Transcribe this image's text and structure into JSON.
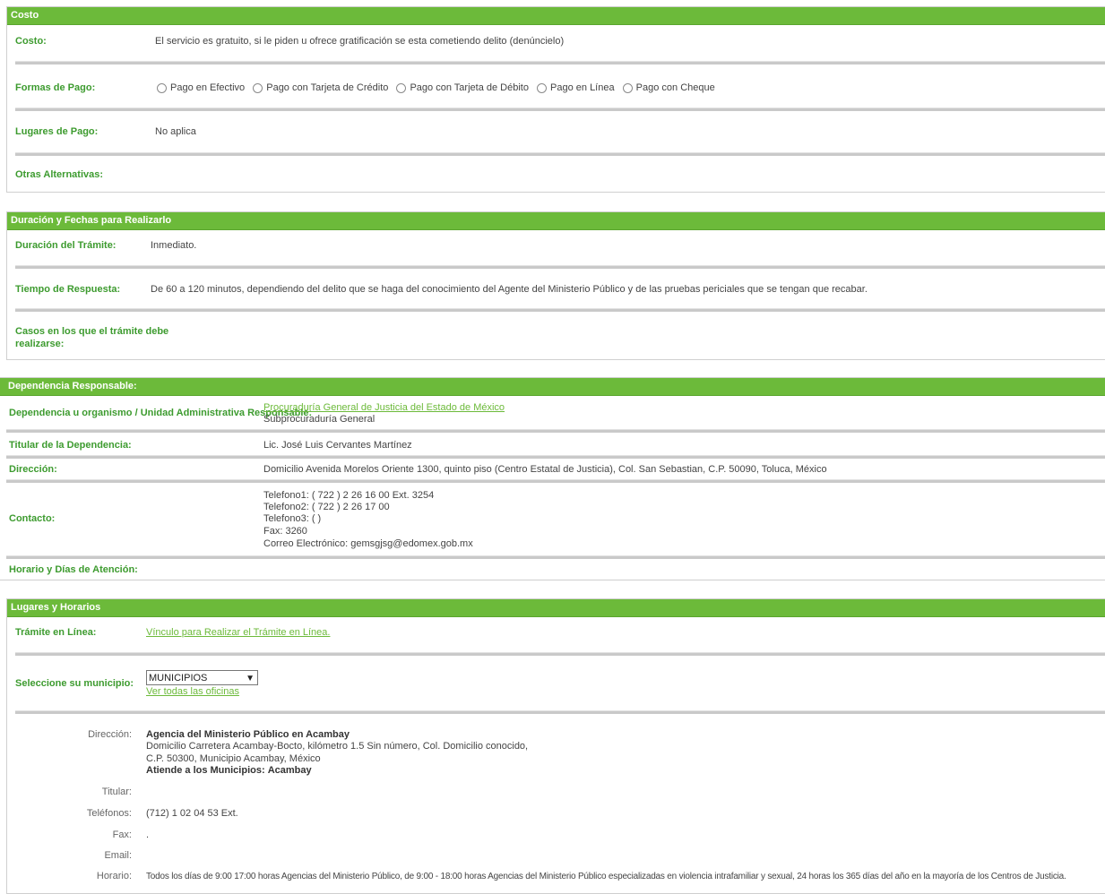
{
  "costo": {
    "header": "Costo",
    "costo_label": "Costo:",
    "costo_value": "El servicio es gratuito, si le piden u ofrece gratificación se esta cometiendo delito (denúncielo)",
    "formas_label": "Formas de Pago:",
    "formas_options": [
      "Pago en Efectivo",
      "Pago con Tarjeta de Crédito",
      "Pago con Tarjeta de Débito",
      "Pago en Línea",
      "Pago con Cheque"
    ],
    "lugares_label": "Lugares de Pago:",
    "lugares_value": "No aplica",
    "otras_label": "Otras Alternativas:"
  },
  "duracion": {
    "header": "Duración y Fechas para Realizarlo",
    "duracion_label": "Duración del Trámite:",
    "duracion_value": "Inmediato.",
    "tiempo_label": "Tiempo de Respuesta:",
    "tiempo_value": "De 60 a 120 minutos, dependiendo del delito que se haga del conocimiento del Agente del Ministerio Público y de las pruebas periciales que se tengan que recabar.",
    "casos_label_1": "Casos en los que el trámite debe",
    "casos_label_2": "realizarse:"
  },
  "dependencia": {
    "header": "Dependencia Responsable:",
    "dep_label": "Dependencia u organismo / Unidad Administrativa Responsable:",
    "dep_link": "Procuraduría General de Justicia del Estado de México",
    "dep_sub": "Subprocuraduría General",
    "titular_label": "Titular de la Dependencia:",
    "titular_value": "Lic. José Luis Cervantes Martínez",
    "direccion_label": "Dirección:",
    "direccion_value": "Domicilio Avenida Morelos Oriente 1300, quinto piso (Centro Estatal de Justicia), Col. San Sebastian, C.P. 50090, Toluca, México",
    "contacto_label": "Contacto:",
    "contacto_lines": [
      "Telefono1: ( 722 ) 2 26 16 00 Ext. 3254",
      "Telefono2: ( 722 ) 2 26 17 00",
      "Telefono3: ( )",
      "Fax: 3260",
      "Correo Electrónico: gemsgjsg@edomex.gob.mx"
    ],
    "horario_label": "Horario y Días de Atención:"
  },
  "lugares": {
    "header": "Lugares y Horarios",
    "tramite_label": "Trámite en Línea:",
    "tramite_link": "Vínculo para Realizar el Trámite en Línea.",
    "municipio_label": "Seleccione su municipio:",
    "municipio_selected": "MUNICIPIOS",
    "ver_oficinas": "Ver todas las oficinas",
    "detail": {
      "direccion_label": "Dirección:",
      "agencia": "Agencia del Ministerio Público en Acambay",
      "domicilio": "Domicilio Carretera Acambay-Bocto, kilómetro 1.5 Sin número, Col. Domicilio conocido,",
      "cp": "C.P. 50300, Municipio Acambay, México",
      "atiende_label": "Atiende a los Municipios:",
      "atiende_value": "Acambay",
      "titular_label": "Titular:",
      "titular_value": "",
      "telefonos_label": "Teléfonos:",
      "telefonos_value": "(712) 1 02 04 53 Ext.",
      "fax_label": "Fax:",
      "fax_value": ".",
      "email_label": "Email:",
      "email_value": "",
      "horario_label": "Horario:",
      "horario_value": "Todos los días de 9:00 17:00 horas Agencias del Ministerio Público, de 9:00 - 18:00 horas Agencias del Ministerio Público especializadas en violencia intrafamiliar y sexual, 24 horas los 365 días del año en la mayoría de los Centros de Justicia."
    }
  }
}
